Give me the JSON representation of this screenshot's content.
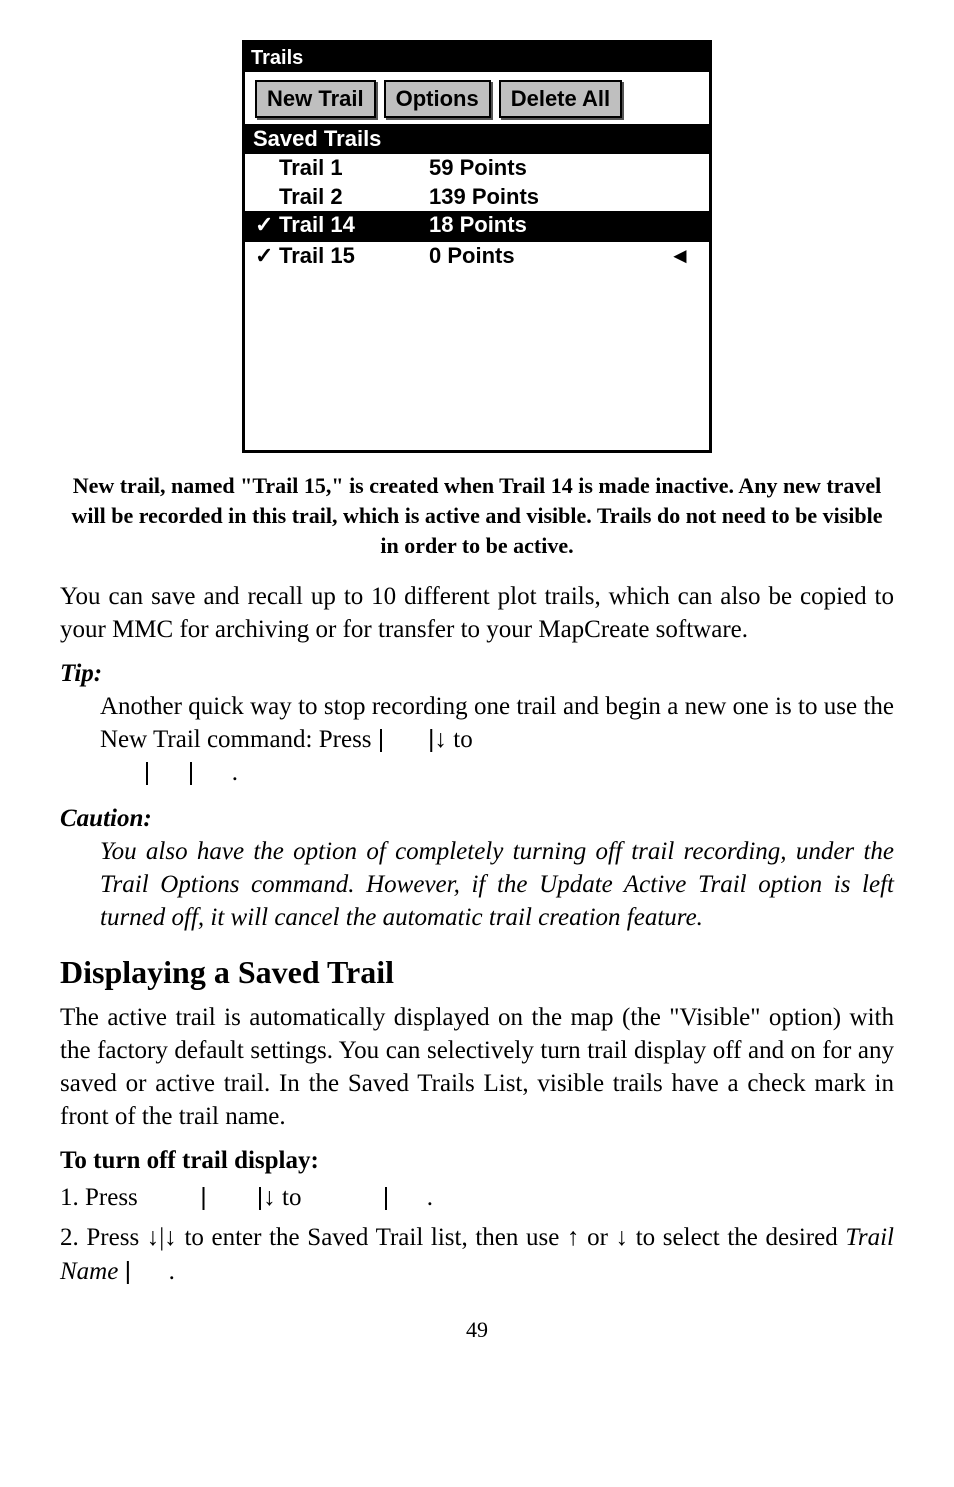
{
  "screenshot": {
    "title": "Trails",
    "buttons": {
      "new_trail": "New Trail",
      "options": "Options",
      "delete_all": "Delete All"
    },
    "section_header": "Saved Trails",
    "rows": [
      {
        "check": "",
        "name": "Trail 1",
        "points": "59 Points",
        "cursor": ""
      },
      {
        "check": "",
        "name": "Trail 2",
        "points": "139 Points",
        "cursor": ""
      },
      {
        "check": "✓",
        "name": "Trail 14",
        "points": "18 Points",
        "cursor": ""
      },
      {
        "check": "✓",
        "name": "Trail 15",
        "points": "0 Points",
        "cursor": "◄"
      }
    ]
  },
  "caption": "New trail, named \"Trail 15,\" is created when Trail 14 is made inactive. Any new travel will be recorded in this trail, which is active and visible. Trails do not need to be visible in order to be active.",
  "para_intro": "You can save and recall up to 10 different plot trails, which can also be copied to your MMC for archiving or for transfer to your MapCreate software.",
  "tip": {
    "label": "Tip:",
    "line1_a": "Another quick way to stop recording one trail and begin a new one is to use the New Trail command: Press ",
    "line1_b": " to ",
    "line1_c": "."
  },
  "caution": {
    "label": "Caution:",
    "body": "You also have the option of completely turning off trail recording, under the Trail Options command. However, if the Update Active Trail option is left turned off, it will cancel the automatic trail creation feature."
  },
  "heading": "Displaying a Saved Trail",
  "para_display": "The active trail is automatically displayed on the map (the \"Visible\" option) with the factory default settings. You can selectively turn trail display off and on for any saved or active trail. In the Saved Trails List, visible trails have a check mark in front of the trail name.",
  "subhead": "To turn off trail display:",
  "steps": {
    "s1_a": "1. Press ",
    "s1_b": " to ",
    "s1_c": ".",
    "s2_a": "2. Press ↓|↓ to enter the Saved Trail list, then use ↑ or ↓ to select the desired ",
    "s2_b": "Trail Name",
    "s2_c": "|",
    "s2_d": "."
  },
  "glyphs": {
    "pipe": "|",
    "down": "↓",
    "pipe_down": "|↓"
  },
  "page": "49"
}
